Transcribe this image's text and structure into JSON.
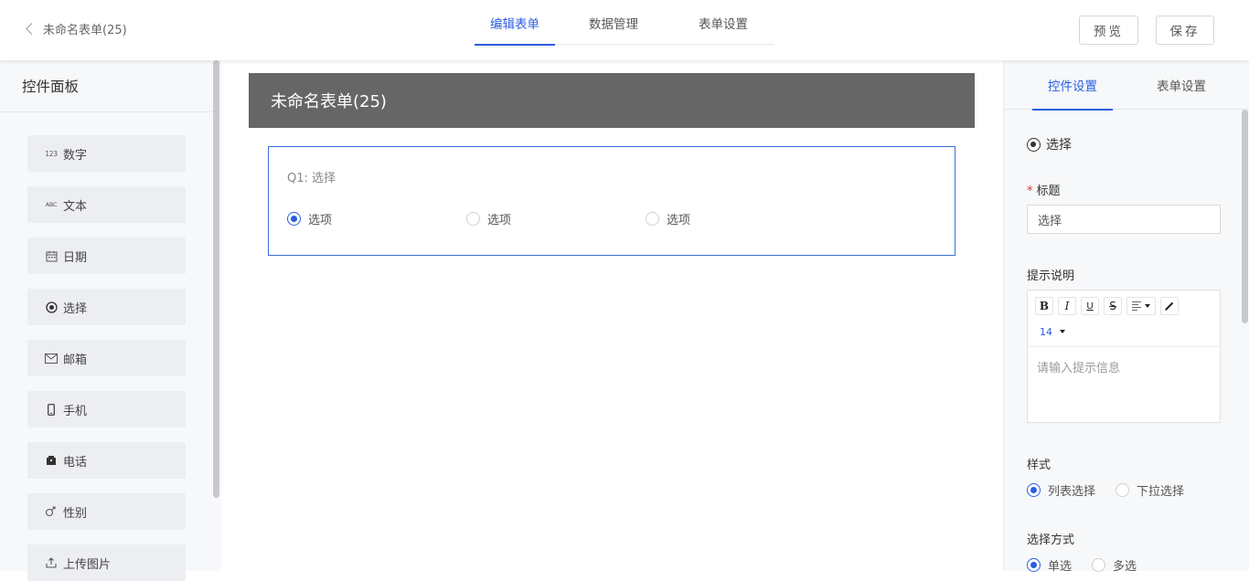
{
  "header": {
    "back_title": "未命名表单(25)",
    "tabs": [
      {
        "label": "编辑表单",
        "active": true
      },
      {
        "label": "数据管理",
        "active": false
      },
      {
        "label": "表单设置",
        "active": false
      }
    ],
    "preview_label": "预览",
    "save_label": "保存"
  },
  "left_panel": {
    "title": "控件面板",
    "controls": [
      {
        "label": "数字",
        "icon": "number-123-icon",
        "glyph": "123"
      },
      {
        "label": "文本",
        "icon": "text-abc-icon",
        "glyph": "ABC"
      },
      {
        "label": "日期",
        "icon": "calendar-icon",
        "glyph": "📅"
      },
      {
        "label": "选择",
        "icon": "radio-icon",
        "glyph": "◉"
      },
      {
        "label": "邮箱",
        "icon": "envelope-icon",
        "glyph": "✉"
      },
      {
        "label": "手机",
        "icon": "mobile-phone-icon",
        "glyph": "▯"
      },
      {
        "label": "电话",
        "icon": "telephone-icon",
        "glyph": "☎"
      },
      {
        "label": "性别",
        "icon": "gender-icon",
        "glyph": "⚥"
      },
      {
        "label": "上传图片",
        "icon": "upload-icon",
        "glyph": "⤒"
      }
    ]
  },
  "canvas": {
    "form_title": "未命名表单(25)",
    "question": {
      "title": "Q1: 选择",
      "options": [
        {
          "label": "选项",
          "selected": true
        },
        {
          "label": "选项",
          "selected": false
        },
        {
          "label": "选项",
          "selected": false
        }
      ]
    }
  },
  "right_panel": {
    "tabs": [
      {
        "label": "控件设置",
        "active": true
      },
      {
        "label": "表单设置",
        "active": false
      }
    ],
    "control_type": "选择",
    "title_label": "标题",
    "required_mark": "*",
    "title_value": "选择",
    "hint_label": "提示说明",
    "editor": {
      "bold": "B",
      "italic": "I",
      "underline": "U",
      "strike": "S",
      "font_size": "14",
      "placeholder": "请输入提示信息"
    },
    "style_label": "样式",
    "style_options": [
      {
        "label": "列表选择",
        "selected": true
      },
      {
        "label": "下拉选择",
        "selected": false
      }
    ],
    "mode_label": "选择方式",
    "mode_options": [
      {
        "label": "单选",
        "selected": true
      },
      {
        "label": "多选",
        "selected": false
      }
    ]
  },
  "colors": {
    "accent": "#2b5de0",
    "banner": "#666666",
    "panel_bg": "#f6f8fa",
    "required": "#e0342b"
  }
}
